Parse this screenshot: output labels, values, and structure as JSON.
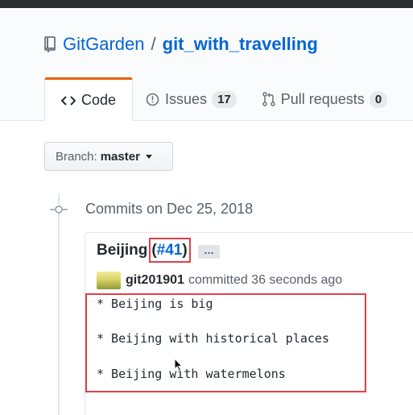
{
  "repo": {
    "owner": "GitGarden",
    "separator": "/",
    "name": "git_with_travelling",
    "icon": "repo-icon"
  },
  "tabs": [
    {
      "label": "Code",
      "icon": "code-icon",
      "selected": true
    },
    {
      "label": "Issues",
      "icon": "issue-opened-icon",
      "count": "17"
    },
    {
      "label": "Pull requests",
      "icon": "git-pull-request-icon",
      "count": "0"
    }
  ],
  "branch": {
    "label": "Branch:",
    "value": "master"
  },
  "commits": {
    "heading": "Commits on Dec 25, 2018",
    "commit": {
      "title": "Beijing",
      "pr_open": "(",
      "pr_number": "#41",
      "pr_close": ")",
      "ellipsis": "…",
      "author": "git201901",
      "action": "committed 36 seconds ago",
      "body": [
        "* Beijing is big",
        "* Beijing with historical places",
        "* Beijing with watermelons"
      ]
    }
  },
  "colors": {
    "link": "#0366d6",
    "tab_accent": "#e36209",
    "highlight": "#e0404a"
  }
}
